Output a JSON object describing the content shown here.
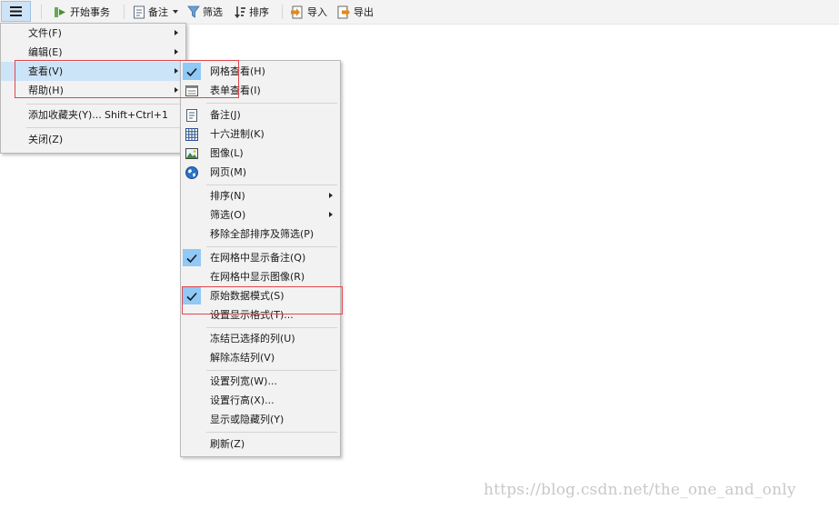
{
  "toolbar": {
    "menu_icon": "hamburger-menu-icon",
    "start_transaction": "开始事务",
    "note": "备注",
    "filter": "筛选",
    "sort": "排序",
    "import": "导入",
    "export": "导出"
  },
  "main_menu": {
    "items": [
      {
        "label": "文件(F)",
        "submenu": true
      },
      {
        "label": "编辑(E)",
        "submenu": true
      },
      {
        "label": "查看(V)",
        "submenu": true,
        "active": true
      },
      {
        "label": "帮助(H)",
        "submenu": true
      },
      {
        "label": "添加收藏夹(Y)...",
        "shortcut": "Shift+Ctrl+1"
      },
      {
        "label": "关闭(Z)"
      }
    ]
  },
  "view_menu": {
    "items": [
      {
        "label": "网格查看(H)",
        "checked": true,
        "icon": "check-icon"
      },
      {
        "label": "表单查看(I)",
        "icon": "form-view-icon"
      },
      {
        "label": "备注(J)",
        "icon": "note-icon"
      },
      {
        "label": "十六进制(K)",
        "icon": "hex-grid-icon"
      },
      {
        "label": "图像(L)",
        "icon": "image-icon"
      },
      {
        "label": "网页(M)",
        "icon": "globe-icon"
      },
      {
        "label": "排序(N)",
        "submenu": true
      },
      {
        "label": "筛选(O)",
        "submenu": true
      },
      {
        "label": "移除全部排序及筛选(P)"
      },
      {
        "label": "在网格中显示备注(Q)",
        "checked": true,
        "icon": "check-icon"
      },
      {
        "label": "在网格中显示图像(R)"
      },
      {
        "label": "原始数据模式(S)",
        "checked": true,
        "icon": "check-icon"
      },
      {
        "label": "设置显示格式(T)..."
      },
      {
        "label": "冻结已选择的列(U)"
      },
      {
        "label": "解除冻结列(V)"
      },
      {
        "label": "设置列宽(W)..."
      },
      {
        "label": "设置行高(X)..."
      },
      {
        "label": "显示或隐藏列(Y)"
      },
      {
        "label": "刷新(Z)"
      }
    ]
  },
  "watermark": "https://blog.csdn.net/the_one_and_only",
  "colors": {
    "menu_bg": "#f2f2f2",
    "highlight": "#cce4f7",
    "check_bg": "#90c8f6",
    "annotation_red": "#e0464c",
    "toolbar_bg": "#f3f3f3"
  }
}
